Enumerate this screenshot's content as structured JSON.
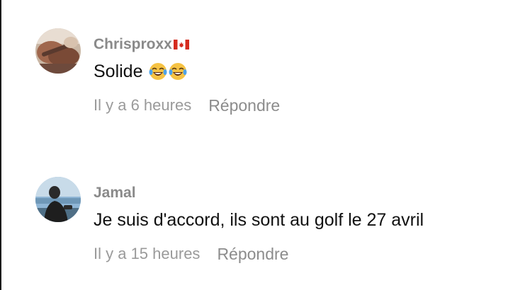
{
  "comments": [
    {
      "username": "Chrisproxx",
      "flag": "canada-flag-icon",
      "text": "Solide",
      "emoji": [
        "face-with-tears-of-joy-icon",
        "face-with-tears-of-joy-icon"
      ],
      "time": "Il y a 6 heures",
      "reply_label": "Répondre"
    },
    {
      "username": "Jamal",
      "text": "Je suis d'accord, ils sont au golf le 27 avril",
      "time": "Il y a 15 heures",
      "reply_label": "Répondre"
    }
  ],
  "colors": {
    "username": "#8a8a8a",
    "text": "#111111",
    "meta": "#9a9a9a"
  }
}
